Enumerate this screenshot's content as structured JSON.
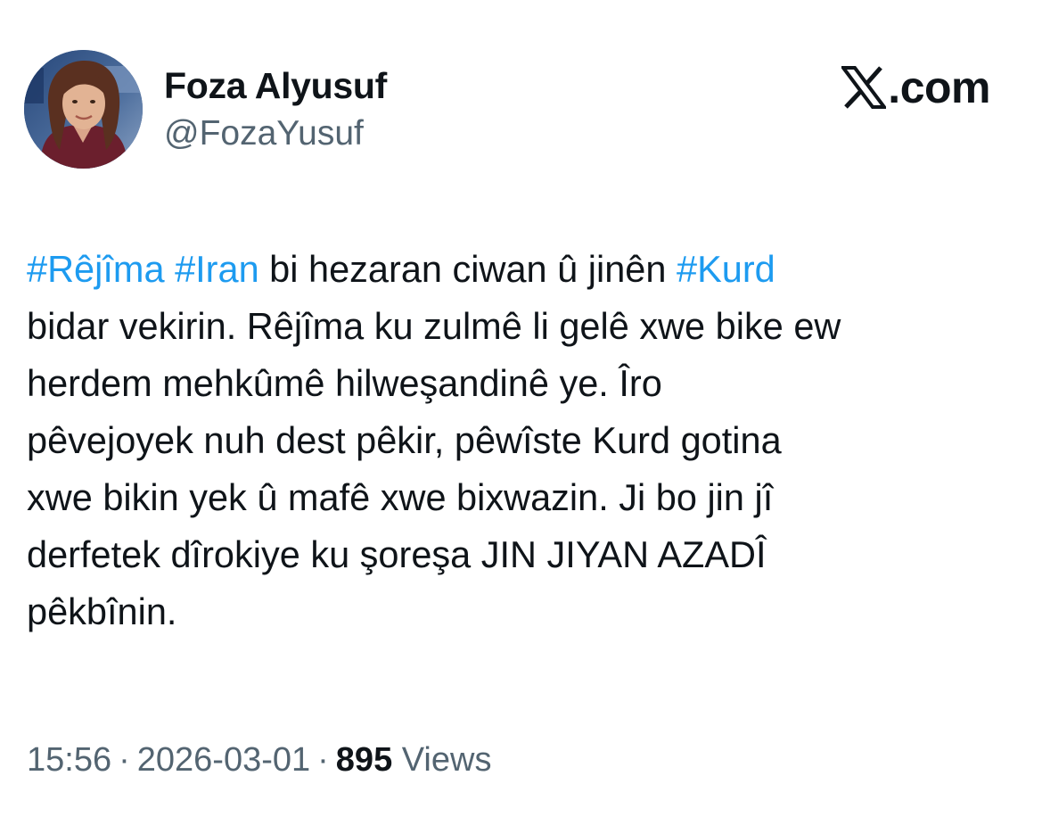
{
  "author": {
    "display_name": "Foza Alyusuf",
    "handle": "@FozaYusuf",
    "avatar_icon": "profile-photo-icon"
  },
  "brand": {
    "logo_icon": "x-logo-icon",
    "domain": ".com"
  },
  "tweet": {
    "segments": [
      {
        "type": "hashtag",
        "text": "#Rêjîma"
      },
      {
        "type": "text",
        "text": " "
      },
      {
        "type": "hashtag",
        "text": "#Iran"
      },
      {
        "type": "text",
        "text": " bi hezaran ciwan û jinên "
      },
      {
        "type": "hashtag",
        "text": "#Kurd"
      },
      {
        "type": "text",
        "text": "\nbidar vekirin. Rêjîma ku zulmê li gelê xwe bike ew\nherdem mehkûmê hilweşandinê ye. Îro\npêvejoyek nuh dest pêkir, pêwîste Kurd gotina\nxwe bikin yek û mafê xwe bixwazin. Ji bo jin jî\nderfetek dîrokiye ku şoreşa JIN JIYAN AZADÎ\npêkbînin."
      }
    ]
  },
  "meta": {
    "time": "15:56",
    "separator": "·",
    "date": "2026-03-01",
    "views_count": "895",
    "views_label": "Views"
  },
  "colors": {
    "text": "#0f1419",
    "secondary": "#536471",
    "link": "#1d9bf0",
    "background": "#ffffff"
  }
}
